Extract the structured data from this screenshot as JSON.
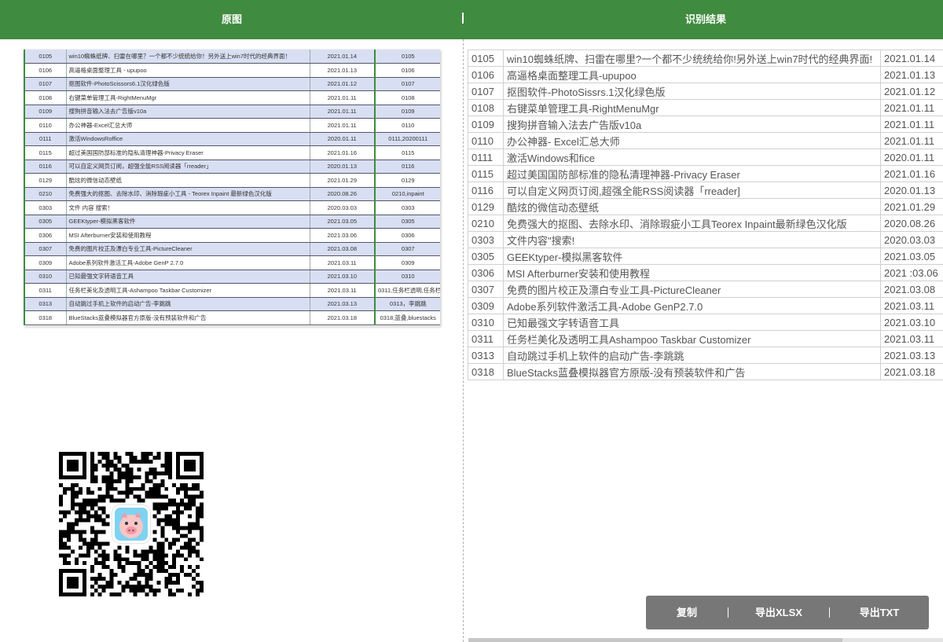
{
  "header": {
    "left_title": "原图",
    "separator": "|",
    "right_title": "识别结果"
  },
  "original_rows": [
    [
      "0105",
      "win10蜘蛛纸牌、扫雷在哪里？一个都不少统统给你！另外送上win7时代的经典界面！",
      "2021.01.14",
      "0105"
    ],
    [
      "0106",
      "高逼格桌面整理工具 - upupoo",
      "2021.01.13",
      "0106"
    ],
    [
      "0107",
      "抠图软件-PhotoScissors6.1汉化绿色版",
      "2021.01.12",
      "0107"
    ],
    [
      "0108",
      "右键菜单管理工具-RightMenuMgr",
      "2021.01.11",
      "0108"
    ],
    [
      "0109",
      "搜狗拼音输入法去广告版v10a",
      "2021.01.11",
      "0109"
    ],
    [
      "0110",
      "办公神器-Excel汇总大师",
      "2021.01.11",
      "0110"
    ],
    [
      "0111",
      "激活WindowsRoffice",
      "2020.01.11",
      "0111,20200111"
    ],
    [
      "0115",
      "超过美国国防部标准的隐私清理神器-Privacy Eraser",
      "2021.01.16",
      "0115"
    ],
    [
      "0116",
      "可以自定义网页订阅，超强全能RSS阅读器「rreader」",
      "2020.01.13",
      "0116"
    ],
    [
      "0129",
      "酷炫的微信动态壁纸",
      "2021.01.29",
      "0129"
    ],
    [
      "0210",
      "免费强大的抠图、去除水印、消除瑕疵小工具 - Teorex Inpaint 最新绿色汉化版",
      "2020.08.26",
      "0210,inpaint"
    ],
    [
      "0303",
      "文件 内容 搜索！",
      "2020.03.03",
      "0303"
    ],
    [
      "0305",
      "GEEKtyper-模拟黑客软件",
      "2021.03.05",
      "0305"
    ],
    [
      "0306",
      "MSI Afterburner安装和使用教程",
      "2021.03.06",
      "0306"
    ],
    [
      "0307",
      "免费的图片校正及漂白专业工具-PictureCleaner",
      "2021.03.08",
      "0307"
    ],
    [
      "0309",
      "Adobe系列软件激活工具-Adobe GenP 2.7.0",
      "2021.03.11",
      "0309"
    ],
    [
      "0310",
      "已知最强文字转语音工具",
      "2021.03.10",
      "0310"
    ],
    [
      "0311",
      "任务栏美化及透明工具-Ashampoo Taskbar Customizer",
      "2021.03.11",
      "0311,任务栏透明,任务栏"
    ],
    [
      "0313",
      "自动跳过手机上软件的启动广告-李跳跳",
      "2021.03.13",
      "0313，李跳跳"
    ],
    [
      "0318",
      "BlueStacks蓝叠模拟器官方原版-没有预装软件和广告",
      "2021.03.18",
      "0318,蓝叠,bluestacks"
    ]
  ],
  "result_rows": [
    [
      "0105",
      "win10蜘蛛纸牌、扫雷在哪里?一个都不少统统给你!另外送上win7时代的经典界面!",
      "2021.01.14"
    ],
    [
      "0106",
      "高逼格桌面整理工具-upupoo",
      "2021.01.13"
    ],
    [
      "0107",
      "抠图软件-PhotoSissrs.1汉化绿色版",
      "2021.01.12"
    ],
    [
      "0108",
      "右键菜单管理工具-RightMenuMgr",
      "2021.01.11"
    ],
    [
      "0109",
      "搜狗拼音输入法去广告版v10a",
      "2021.01.11"
    ],
    [
      "0110",
      "办公神器- Excel汇总大师",
      "2021.01.11"
    ],
    [
      "0111",
      "激活Windows和fice",
      "2020.01.11"
    ],
    [
      "0115",
      "超过美国国防部标准的隐私清理神器-Privacy Eraser",
      "2021.01.16"
    ],
    [
      "0116",
      "可以自定义网页订阅,超强全能RSS阅读器「rreader]",
      "2020.01.13"
    ],
    [
      "0129",
      "酷炫的微信动态壁纸",
      "2021.01.29"
    ],
    [
      "0210",
      "免费强大的抠图、去除水印、消除瑕疵小工具Teorex Inpaint最新绿色汉化版",
      "2020.08.26"
    ],
    [
      "0303",
      "文件内容\"搜索!",
      "2020.03.03"
    ],
    [
      "0305",
      "GEEKtyper-模拟黑客软件",
      "2021.03.05"
    ],
    [
      "0306",
      "MSI Afterburner安装和使用教程",
      "2021 :03.06"
    ],
    [
      "0307",
      "免费的图片校正及漂白专业工具-PictureCleaner",
      "2021.03.08"
    ],
    [
      "0309",
      "Adobe系列软件激活工具-Adobe GenP2.7.0",
      "2021.03.11"
    ],
    [
      "0310",
      "已知最强文字转语音工具",
      "2021.03.10"
    ],
    [
      "0311",
      "任务栏美化及透明工具Ashampoo Taskbar Customizer",
      "2021.03.11"
    ],
    [
      "0313",
      "自动跳过手机上软件的启动广告-李跳跳",
      "2021.03.13"
    ],
    [
      "0318",
      "BlueStacks蓝叠模拟器官方原版-没有预装软件和广告",
      "2021.03.18"
    ]
  ],
  "actions": {
    "copy_label": "复制",
    "export_xlsx_label": "导出XLSX",
    "export_txt_label": "导出TXT",
    "separator": "|"
  },
  "qr_code": {
    "icon": "qr-code-icon",
    "avatar_icon": "pig-avatar-icon"
  },
  "colors": {
    "header_bg": "#3f8b3f",
    "action_bg": "#777777",
    "row_alt": "#d9dff2"
  }
}
